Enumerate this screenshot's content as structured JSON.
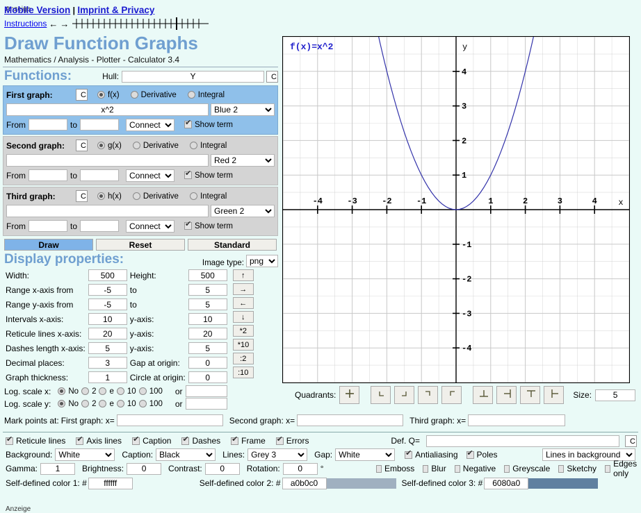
{
  "ads": {
    "top": "Anzeige",
    "bottom": "Anzeige"
  },
  "header": {
    "links": [
      {
        "label": "Mobile Version"
      },
      {
        "label": "Imprint & Privacy"
      },
      {
        "label": "Instructions"
      }
    ],
    "separator": "|",
    "arrow_left": "←",
    "arrow_right": "→",
    "title": "Draw Function Graphs",
    "subtitle": "Mathematics / Analysis - Plotter - Calculator 3.4"
  },
  "functions": {
    "section_title": "Functions:",
    "hull_label": "Hull:",
    "hull_value": "Y",
    "hull_clear": "C",
    "graphs": [
      {
        "name": "First graph:",
        "clear": "C",
        "modes": [
          "f(x)",
          "Derivative",
          "Integral"
        ],
        "mode_selected": "f(x)",
        "expression": "x^2",
        "color": "Blue 2",
        "from_label": "From",
        "from_value": "",
        "to_label": "to",
        "to_value": "",
        "connect": "Connect",
        "show_term_label": "Show term",
        "show_term": true
      },
      {
        "name": "Second graph:",
        "clear": "C",
        "modes": [
          "g(x)",
          "Derivative",
          "Integral"
        ],
        "mode_selected": "g(x)",
        "expression": "",
        "color": "Red 2",
        "from_label": "From",
        "from_value": "",
        "to_label": "to",
        "to_value": "",
        "connect": "Connect",
        "show_term_label": "Show term",
        "show_term": true
      },
      {
        "name": "Third graph:",
        "clear": "C",
        "modes": [
          "h(x)",
          "Derivative",
          "Integral"
        ],
        "mode_selected": "h(x)",
        "expression": "",
        "color": "Green 2",
        "from_label": "From",
        "from_value": "",
        "to_label": "to",
        "to_value": "",
        "connect": "Connect",
        "show_term_label": "Show term",
        "show_term": true
      }
    ],
    "buttons": {
      "draw": "Draw",
      "reset": "Reset",
      "standard": "Standard"
    }
  },
  "display": {
    "section_title": "Display properties:",
    "image_type_label": "Image type:",
    "image_type": "png",
    "fields": {
      "width_label": "Width:",
      "width": "500",
      "height_label": "Height:",
      "height": "500",
      "range_x_label": "Range x-axis from",
      "range_x_from": "-5",
      "range_x_to_label": "to",
      "range_x_to": "5",
      "range_y_label": "Range y-axis from",
      "range_y_from": "-5",
      "range_y_to_label": "to",
      "range_y_to": "5",
      "intervals_x_label": "Intervals x-axis:",
      "intervals_x": "10",
      "intervals_y_label": "y-axis:",
      "intervals_y": "10",
      "reticule_x_label": "Reticule lines x-axis:",
      "reticule_x": "20",
      "reticule_y_label": "y-axis:",
      "reticule_y": "20",
      "dashes_x_label": "Dashes length x-axis:",
      "dashes_x": "5",
      "dashes_y_label": "y-axis:",
      "dashes_y": "5",
      "decimals_label": "Decimal places:",
      "decimals": "3",
      "gap_origin_label": "Gap at origin:",
      "gap_origin": "0",
      "thickness_label": "Graph thickness:",
      "thickness": "1",
      "circle_origin_label": "Circle at origin:",
      "circle_origin": "0"
    },
    "nav_buttons": [
      "↑",
      "→",
      "←",
      "↓",
      "*2",
      "*10",
      ":2",
      ":10"
    ],
    "log_x_label": "Log. scale x:",
    "log_y_label": "Log. scale y:",
    "log_options": [
      "No",
      "2",
      "e",
      "10",
      "100"
    ],
    "log_x_selected": "No",
    "log_y_selected": "No",
    "log_or_label": "or",
    "log_x_other": "",
    "log_y_other": "",
    "mark_label": "Mark points at:",
    "mark_first_label": "First graph: x=",
    "mark_first": "",
    "mark_second_label": "Second graph: x=",
    "mark_second": "",
    "mark_third_label": "Third graph: x=",
    "mark_third": ""
  },
  "quadrants": {
    "label": "Quadrants:",
    "buttons": [
      "+",
      "∟",
      "⌐",
      "⌐",
      "⌐",
      "⊥",
      "⊣",
      "⊤",
      "⊢"
    ],
    "size_label": "Size:",
    "size": "5"
  },
  "options": {
    "checkboxes": [
      {
        "label": "Reticule lines",
        "checked": true
      },
      {
        "label": "Axis lines",
        "checked": true
      },
      {
        "label": "Caption",
        "checked": true
      },
      {
        "label": "Dashes",
        "checked": true
      },
      {
        "label": "Frame",
        "checked": true
      },
      {
        "label": "Errors",
        "checked": true
      }
    ],
    "defq_label": "Def. Q=",
    "defq_value": "",
    "defq_clear": "C",
    "background_label": "Background:",
    "background": "White",
    "caption_label": "Caption:",
    "caption": "Black",
    "lines_label": "Lines:",
    "lines": "Grey 3",
    "gap_label": "Gap:",
    "gap": "White",
    "antialiasing_label": "Antialiasing",
    "antialiasing": true,
    "poles_label": "Poles",
    "poles": true,
    "layer_mode": "Lines in background",
    "gamma_label": "Gamma:",
    "gamma": "1",
    "brightness_label": "Brightness:",
    "brightness": "0",
    "contrast_label": "Contrast:",
    "contrast": "0",
    "rotation_label": "Rotation:",
    "rotation": "0",
    "rotation_unit": "°",
    "effects": [
      {
        "label": "Emboss",
        "checked": false
      },
      {
        "label": "Blur",
        "checked": false
      },
      {
        "label": "Negative",
        "checked": false
      },
      {
        "label": "Greyscale",
        "checked": false
      },
      {
        "label": "Sketchy",
        "checked": false
      },
      {
        "label": "Edges only",
        "checked": false
      }
    ],
    "color1_label": "Self-defined color 1: #",
    "color1": "ffffff",
    "color2_label": "Self-defined color 2: #",
    "color2": "a0b0c0",
    "color3_label": "Self-defined color 3: #",
    "color3": "6080a0"
  },
  "chart_data": {
    "type": "line",
    "title": "f(x)=x^2",
    "expression": "x^2",
    "curve_color": "#3333aa",
    "grid_color": "#c8c8c8",
    "axis_color": "#000000",
    "background": "#ffffff",
    "xlabel": "x",
    "ylabel": "y",
    "xlim": [
      -5,
      5
    ],
    "ylim": [
      -5,
      5
    ],
    "x_ticks": [
      -4,
      -3,
      -2,
      -1,
      1,
      2,
      3,
      4
    ],
    "y_ticks": [
      -4,
      -3,
      -2,
      -1,
      1,
      2,
      3,
      4
    ],
    "x_tick_labels": [
      "-4",
      "-3",
      "-2",
      "-1",
      "1",
      "2",
      "3",
      "4"
    ],
    "y_tick_labels": [
      "-4",
      "-3",
      "-2",
      "-1",
      "1",
      "2",
      "3",
      "4"
    ],
    "grid": true,
    "minor_grid_divisions": 2,
    "x": [
      -2.3,
      -2.2,
      -2.1,
      -2.0,
      -1.9,
      -1.8,
      -1.7,
      -1.6,
      -1.5,
      -1.4,
      -1.3,
      -1.2,
      -1.1,
      -1.0,
      -0.9,
      -0.8,
      -0.7,
      -0.6,
      -0.5,
      -0.4,
      -0.3,
      -0.2,
      -0.1,
      0,
      0.1,
      0.2,
      0.3,
      0.4,
      0.5,
      0.6,
      0.7,
      0.8,
      0.9,
      1.0,
      1.1,
      1.2,
      1.3,
      1.4,
      1.5,
      1.6,
      1.7,
      1.8,
      1.9,
      2.0,
      2.1,
      2.2,
      2.3
    ],
    "y": [
      5.29,
      4.84,
      4.41,
      4.0,
      3.61,
      3.24,
      2.89,
      2.56,
      2.25,
      1.96,
      1.69,
      1.44,
      1.21,
      1.0,
      0.81,
      0.64,
      0.49,
      0.36,
      0.25,
      0.16,
      0.09,
      0.04,
      0.01,
      0,
      0.01,
      0.04,
      0.09,
      0.16,
      0.25,
      0.36,
      0.49,
      0.64,
      0.81,
      1.0,
      1.21,
      1.44,
      1.69,
      1.96,
      2.25,
      2.56,
      2.89,
      3.24,
      3.61,
      4.0,
      4.41,
      4.84,
      5.29
    ]
  }
}
